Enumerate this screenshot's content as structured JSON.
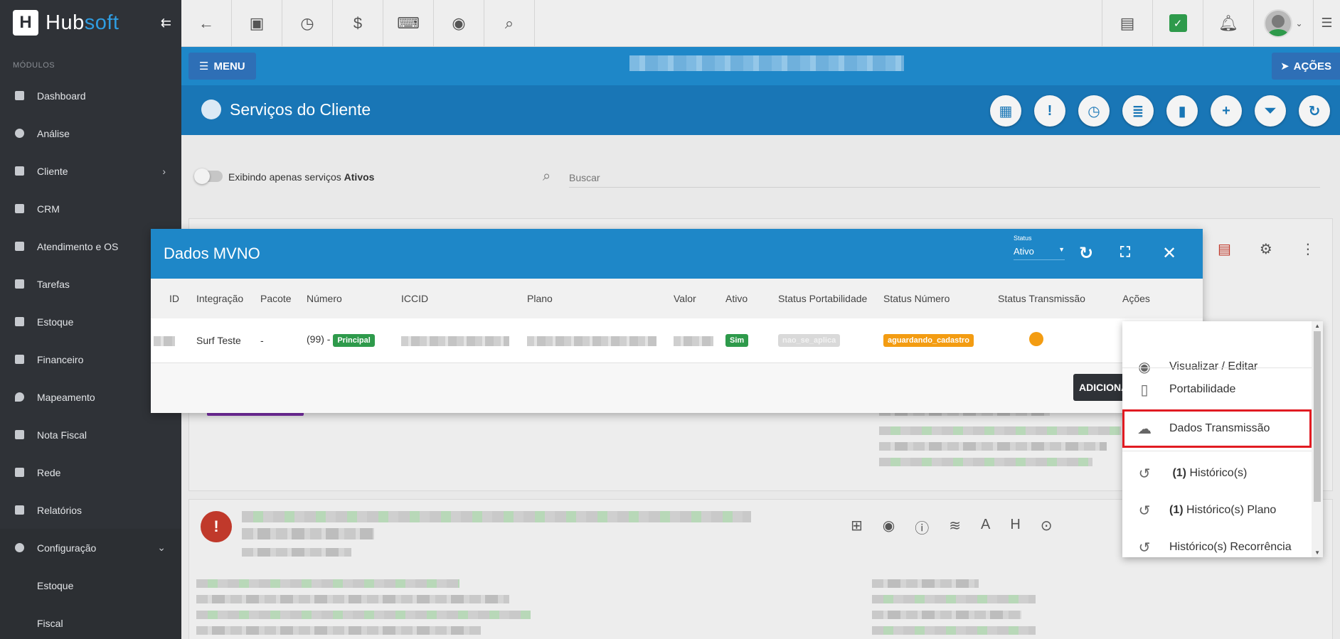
{
  "sidebar": {
    "logo": "Hubsoft",
    "logo_part1": "Hub",
    "logo_part2": "soft",
    "section_label": "MÓDULOS",
    "items": [
      {
        "label": "Dashboard",
        "icon": "dashboard-icon"
      },
      {
        "label": "Análise",
        "icon": "chart-pie-icon"
      },
      {
        "label": "Cliente",
        "icon": "contact-card-icon"
      },
      {
        "label": "CRM",
        "icon": "trello-board-icon"
      },
      {
        "label": "Atendimento e OS",
        "icon": "calendar-clock-icon"
      },
      {
        "label": "Tarefas",
        "icon": "tasks-icon"
      },
      {
        "label": "Estoque",
        "icon": "box-icon"
      },
      {
        "label": "Financeiro",
        "icon": "money-icon"
      },
      {
        "label": "Mapeamento",
        "icon": "map-pin-icon"
      },
      {
        "label": "Nota Fiscal",
        "icon": "document-icon"
      },
      {
        "label": "Rede",
        "icon": "server-icon"
      },
      {
        "label": "Relatórios",
        "icon": "report-icon"
      },
      {
        "label": "Configuração",
        "icon": "gear-icon"
      },
      {
        "label": "Estoque"
      },
      {
        "label": "Fiscal"
      }
    ]
  },
  "header": {
    "menu_label": "MENU",
    "actions_label": "AÇÕES",
    "page_title": "Serviços do Cliente"
  },
  "filter": {
    "toggle_label_prefix": "Exibindo apenas serviços",
    "toggle_label_bold": "Ativos",
    "search_placeholder": "Buscar"
  },
  "modal": {
    "title": "Dados MVNO",
    "status_label": "Status",
    "status_value": "Ativo",
    "columns": [
      "ID",
      "Integração",
      "Pacote",
      "Número",
      "ICCID",
      "Plano",
      "Valor",
      "Ativo",
      "Status Portabilidade",
      "Status Número",
      "Status Transmissão",
      "Ações"
    ],
    "row": {
      "integracao": "Surf Teste",
      "pacote": "-",
      "numero_prefix": "(99) -",
      "numero_badge": "Principal",
      "ativo": "Sim",
      "status_portabilidade": "nao_se_aplica",
      "status_numero": "aguardando_cadastro"
    },
    "add_button": "ADICIONAR"
  },
  "dropdown": {
    "items": [
      {
        "label": "Visualizar / Editar",
        "icon": "eye-icon"
      },
      {
        "label": "Portabilidade",
        "icon": "phone-icon"
      },
      {
        "label": "Dados Transmissão",
        "icon": "cloud-upload-icon"
      },
      {
        "count": "(1)",
        "label": "Histórico(s)",
        "icon": "history-icon"
      },
      {
        "count": "(1)",
        "label": "Histórico(s) Plano",
        "icon": "history-icon"
      },
      {
        "label": "Histórico(s) Recorrência",
        "icon": "history-icon"
      }
    ]
  },
  "colors": {
    "sidebar_bg": "#2f3237",
    "header_blue": "#1e87c8",
    "title_blue": "#1976b6",
    "success_green": "#2e9a4b",
    "warning_orange": "#f39c12",
    "highlight_red": "#e11b22"
  }
}
